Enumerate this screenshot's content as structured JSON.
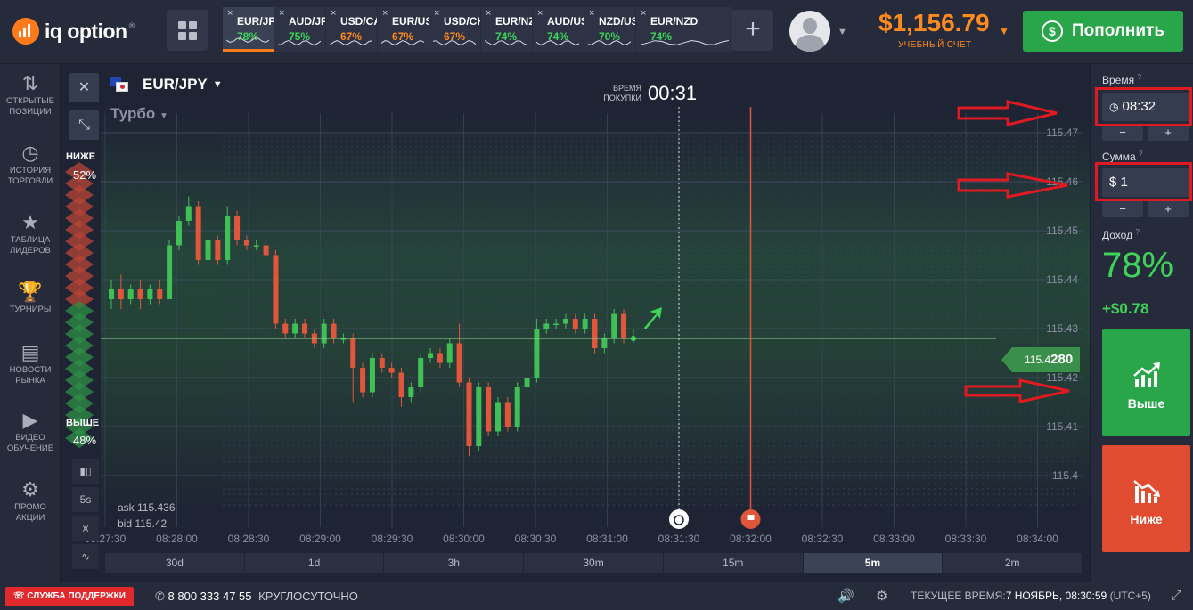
{
  "header": {
    "logo_text": "iq option",
    "logo_reg": "®",
    "tabs": [
      {
        "symbol": "EUR/JP",
        "payout": "78%",
        "color": "#3fd35a",
        "active": true
      },
      {
        "symbol": "AUD/JP",
        "payout": "75%",
        "color": "#3fd35a"
      },
      {
        "symbol": "USD/CA",
        "payout": "67%",
        "color": "#ff8a1e"
      },
      {
        "symbol": "EUR/US",
        "payout": "67%",
        "color": "#ff8a1e"
      },
      {
        "symbol": "USD/CH",
        "payout": "67%",
        "color": "#ff8a1e"
      },
      {
        "symbol": "EUR/NZ",
        "payout": "74%",
        "color": "#3fd35a"
      },
      {
        "symbol": "AUD/US",
        "payout": "74%",
        "color": "#3fd35a"
      },
      {
        "symbol": "NZD/US",
        "payout": "70%",
        "color": "#3fd35a"
      },
      {
        "symbol": "EUR/NZD",
        "payout": "74%",
        "color": "#3fd35a"
      }
    ],
    "tab_close": "×",
    "add_tab": "+",
    "balance": "$1,156.79",
    "balance_label": "УЧЕБНЫЙ СЧЕТ",
    "deposit_label": "Пополнить",
    "deposit_icon": "$"
  },
  "sidebar": {
    "items": [
      {
        "label1": "ОТКРЫТЫЕ",
        "label2": "ПОЗИЦИИ",
        "icon": "⇅"
      },
      {
        "label1": "ИСТОРИЯ",
        "label2": "ТОРГОВЛИ",
        "icon": "◷"
      },
      {
        "label1": "ТАБЛИЦА",
        "label2": "ЛИДЕРОВ",
        "icon": "★"
      },
      {
        "label1": "ТУРНИРЫ",
        "label2": "",
        "icon": "🏆"
      },
      {
        "label1": "НОВОСТИ",
        "label2": "РЫНКА",
        "icon": "▤"
      },
      {
        "label1": "ВИДЕО",
        "label2": "ОБУЧЕНИЕ",
        "icon": "▶"
      },
      {
        "label1": "ПРОМО",
        "label2": "АКЦИИ",
        "icon": "⚙"
      }
    ]
  },
  "chart": {
    "pair": "EUR/JPY",
    "mode": "Турбо",
    "close_icon": "✕",
    "collapse_icon": "⤡",
    "sentiment_low_label": "НИЖЕ",
    "sentiment_low_pct": "52%",
    "sentiment_high_label": "ВЫШЕ",
    "sentiment_high_pct": "48%",
    "buy_time_label": "ВРЕМЯ ПОКУПКИ",
    "buy_time": "00:31",
    "ask": "ask 115.436",
    "bid": "bid 115.42",
    "price_tag_prefix": "115.4",
    "price_tag_bold": "280",
    "tools": [
      "5s"
    ],
    "timeframes": [
      "30d",
      "1d",
      "3h",
      "30m",
      "15m",
      "5m",
      "2m"
    ],
    "active_timeframe": "5m"
  },
  "chart_data": {
    "type": "candlestick",
    "y_ticks": [
      "115.47",
      "115.46",
      "115.45",
      "115.44",
      "115.43",
      "115.42",
      "115.41",
      "115.4"
    ],
    "ylim": [
      115.394,
      115.474
    ],
    "x_ticks": [
      "08:27:30",
      "08:28:00",
      "08:28:30",
      "08:29:00",
      "08:29:30",
      "08:30:00",
      "08:30:30",
      "08:31:00",
      "08:31:30",
      "08:32:00",
      "08:32:30",
      "08:33:00",
      "08:33:30",
      "08:34:00"
    ],
    "current_price": 115.428,
    "candles": [
      [
        115.436,
        115.438,
        115.44,
        115.434
      ],
      [
        115.438,
        115.436,
        115.441,
        115.434
      ],
      [
        115.436,
        115.438,
        115.439,
        115.435
      ],
      [
        115.438,
        115.436,
        115.44,
        115.434
      ],
      [
        115.436,
        115.438,
        115.439,
        115.435
      ],
      [
        115.438,
        115.436,
        115.44,
        115.435
      ],
      [
        115.436,
        115.447,
        115.448,
        115.436
      ],
      [
        115.447,
        115.452,
        115.453,
        115.446
      ],
      [
        115.452,
        115.455,
        115.457,
        115.451
      ],
      [
        115.455,
        115.444,
        115.456,
        115.443
      ],
      [
        115.444,
        115.448,
        115.449,
        115.443
      ],
      [
        115.448,
        115.444,
        115.449,
        115.443
      ],
      [
        115.444,
        115.453,
        115.455,
        115.443
      ],
      [
        115.453,
        115.448,
        115.454,
        115.447
      ],
      [
        115.448,
        115.447,
        115.449,
        115.446
      ],
      [
        115.447,
        115.447,
        115.448,
        115.446
      ],
      [
        115.447,
        115.445,
        115.448,
        115.444
      ],
      [
        115.445,
        115.431,
        115.446,
        115.43
      ],
      [
        115.431,
        115.429,
        115.432,
        115.428
      ],
      [
        115.429,
        115.431,
        115.432,
        115.428
      ],
      [
        115.431,
        115.429,
        115.432,
        115.428
      ],
      [
        115.429,
        115.427,
        115.43,
        115.426
      ],
      [
        115.427,
        115.431,
        115.432,
        115.426
      ],
      [
        115.431,
        115.428,
        115.432,
        115.427
      ],
      [
        115.428,
        115.428,
        115.429,
        115.427
      ],
      [
        115.428,
        115.422,
        115.429,
        115.415
      ],
      [
        115.422,
        115.417,
        115.423,
        115.416
      ],
      [
        115.417,
        115.424,
        115.425,
        115.416
      ],
      [
        115.424,
        115.422,
        115.425,
        115.421
      ],
      [
        115.422,
        115.421,
        115.423,
        115.42
      ],
      [
        115.421,
        115.416,
        115.422,
        115.414
      ],
      [
        115.416,
        115.418,
        115.419,
        115.415
      ],
      [
        115.418,
        115.424,
        115.425,
        115.417
      ],
      [
        115.424,
        115.425,
        115.426,
        115.423
      ],
      [
        115.425,
        115.423,
        115.426,
        115.422
      ],
      [
        115.423,
        115.427,
        115.428,
        115.422
      ],
      [
        115.427,
        115.419,
        115.431,
        115.418
      ],
      [
        115.419,
        115.406,
        115.42,
        115.404
      ],
      [
        115.406,
        115.418,
        115.419,
        115.405
      ],
      [
        115.418,
        115.409,
        115.419,
        115.408
      ],
      [
        115.409,
        115.415,
        115.416,
        115.408
      ],
      [
        115.415,
        115.41,
        115.416,
        115.409
      ],
      [
        115.41,
        115.418,
        115.419,
        115.409
      ],
      [
        115.418,
        115.42,
        115.421,
        115.417
      ],
      [
        115.42,
        115.43,
        115.432,
        115.419
      ],
      [
        115.43,
        115.431,
        115.432,
        115.429
      ],
      [
        115.431,
        115.431,
        115.432,
        115.43
      ],
      [
        115.431,
        115.432,
        115.433,
        115.43
      ],
      [
        115.432,
        115.43,
        115.433,
        115.429
      ],
      [
        115.43,
        115.432,
        115.433,
        115.429
      ],
      [
        115.432,
        115.426,
        115.433,
        115.425
      ],
      [
        115.426,
        115.428,
        115.429,
        115.425
      ],
      [
        115.428,
        115.433,
        115.434,
        115.427
      ],
      [
        115.433,
        115.428,
        115.434,
        115.427
      ],
      [
        115.428,
        115.428,
        115.43,
        115.427
      ]
    ],
    "expiry_lines": [
      "08:31:30",
      "08:32:00"
    ]
  },
  "panel": {
    "time_label": "Время",
    "time_value": "08:32",
    "amount_label": "Сумма",
    "amount_value": "$ 1",
    "minus": "−",
    "plus": "+",
    "payout_label": "Доход",
    "payout_pct": "78%",
    "payout_amount": "+$0.78",
    "up_label": "Выше",
    "down_label": "Ниже",
    "help": "?"
  },
  "footer": {
    "support": "СЛУЖБА ПОДДЕРЖКИ",
    "phone": "8 800 333 47 55",
    "phone_hours": "КРУГЛОСУТОЧНО",
    "time_label": "ТЕКУЩЕЕ ВРЕМЯ:",
    "time_value": "7 НОЯБРЬ, 08:30:59",
    "tz": "(UTC+5)"
  },
  "colors": {
    "up": "#3fd35a",
    "down": "#e14b2f",
    "accent": "#ff8a1e",
    "annotation": "#e11a22"
  }
}
